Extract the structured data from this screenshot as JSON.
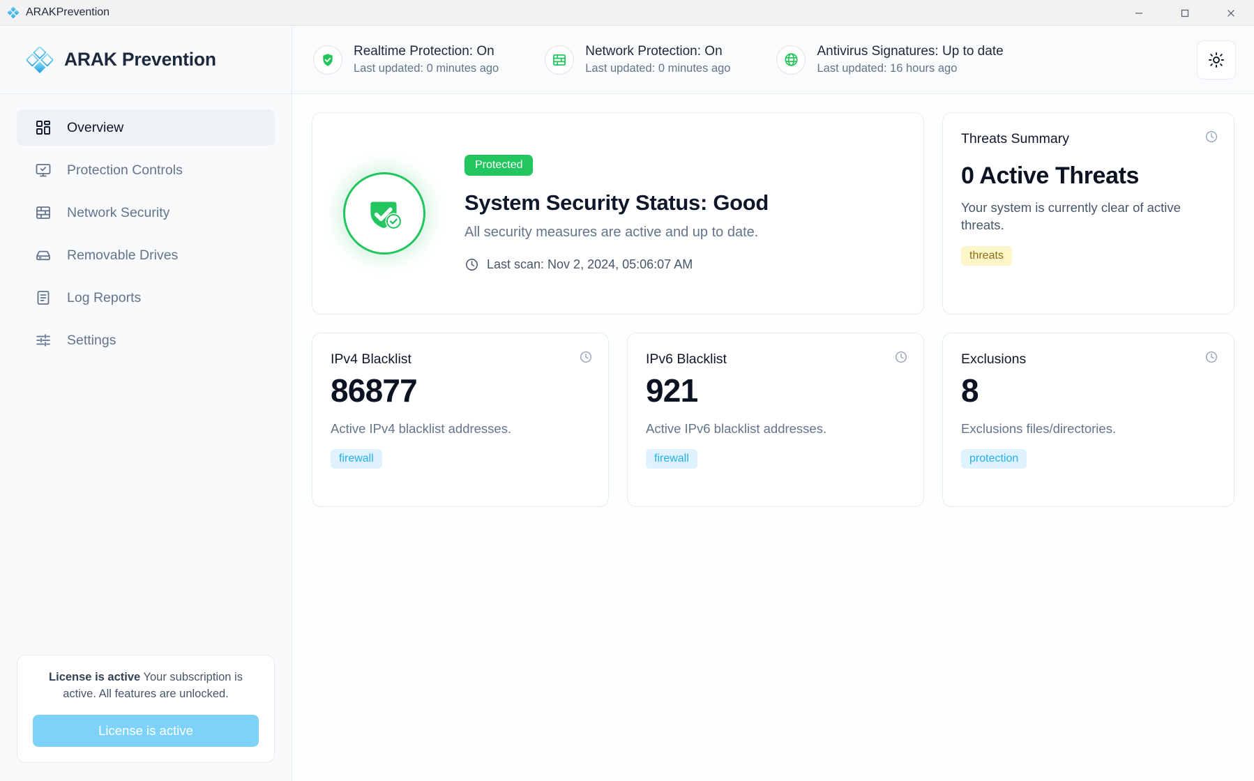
{
  "window": {
    "title": "ARAKPrevention",
    "controls": {
      "minimize": "minimize-icon",
      "maximize": "maximize-icon",
      "close": "close-icon"
    }
  },
  "brand": {
    "name": "ARAK Prevention",
    "logo": "arak-diamond-logo"
  },
  "sidebar": {
    "items": [
      {
        "label": "Overview",
        "icon": "dashboard-grid-icon",
        "active": true
      },
      {
        "label": "Protection Controls",
        "icon": "monitor-check-icon",
        "active": false
      },
      {
        "label": "Network Security",
        "icon": "brick-wall-icon",
        "active": false
      },
      {
        "label": "Removable Drives",
        "icon": "hard-drive-icon",
        "active": false
      },
      {
        "label": "Log Reports",
        "icon": "file-text-icon",
        "active": false
      },
      {
        "label": "Settings",
        "icon": "sliders-icon",
        "active": false
      }
    ],
    "license": {
      "heading": "License is active",
      "message": "Your subscription is active. All features are unlocked.",
      "button_label": "License is active",
      "button_color": "#7dd3f7"
    }
  },
  "topbar": {
    "statuses": [
      {
        "title": "Realtime Protection: On",
        "subtitle": "Last updated: 0 minutes ago",
        "icon": "shield-check-icon",
        "color": "#22c55e"
      },
      {
        "title": "Network Protection: On",
        "subtitle": "Last updated: 0 minutes ago",
        "icon": "brick-wall-icon",
        "color": "#22c55e"
      },
      {
        "title": "Antivirus Signatures: Up to date",
        "subtitle": "Last updated: 16 hours ago",
        "icon": "globe-icon",
        "color": "#22c55e"
      }
    ],
    "theme_toggle": {
      "icon": "sun-icon",
      "label": "Toggle theme"
    }
  },
  "hero": {
    "badge": "Protected",
    "badge_color": "#22c55e",
    "title": "System Security Status: Good",
    "subtitle": "All security measures are active and up to date.",
    "last_scan": "Last scan: Nov 2, 2024, 05:06:07 AM",
    "icon": "shield-check-badge-icon"
  },
  "threats": {
    "heading": "Threats Summary",
    "value": "0 Active Threats",
    "description": "Your system is currently clear of active threats.",
    "tag": "threats",
    "tag_bg": "#fdf6c8",
    "tag_fg": "#8a6d1a",
    "clock_icon": "clock-icon"
  },
  "stats": [
    {
      "heading": "IPv4 Blacklist",
      "value": "86877",
      "description": "Active IPv4 blacklist addresses.",
      "tag": "firewall",
      "tag_bg": "#e0f2fe",
      "tag_fg": "#23b0f0",
      "clock_icon": "clock-icon"
    },
    {
      "heading": "IPv6 Blacklist",
      "value": "921",
      "description": "Active IPv6 blacklist addresses.",
      "tag": "firewall",
      "tag_bg": "#e0f2fe",
      "tag_fg": "#23b0f0",
      "clock_icon": "clock-icon"
    },
    {
      "heading": "Exclusions",
      "value": "8",
      "description": "Exclusions files/directories.",
      "tag": "protection",
      "tag_bg": "#e0f2fe",
      "tag_fg": "#23b0f0",
      "clock_icon": "clock-icon"
    }
  ]
}
